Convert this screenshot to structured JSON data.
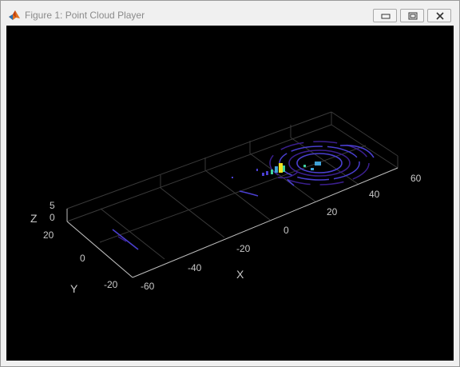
{
  "window": {
    "title": "Figure 1: Point Cloud Player",
    "icon": "matlab-icon",
    "buttons": [
      "minimize-icon",
      "maximize-icon",
      "close-icon"
    ]
  },
  "plot": {
    "background_color": "#000000",
    "axis_color": "#c8c8c8",
    "point_colormap": [
      "#3b1f8f",
      "#4a3fd0",
      "#3fa2d8",
      "#3fd0a0",
      "#f0e020"
    ],
    "axes": {
      "x": {
        "label": "X",
        "ticks": [
          "-60",
          "-40",
          "-20",
          "0",
          "20",
          "40",
          "60"
        ]
      },
      "y": {
        "label": "Y",
        "ticks": [
          "-20",
          "0",
          "20"
        ]
      },
      "z": {
        "label": "Z",
        "ticks": [
          "0",
          "5"
        ]
      }
    }
  }
}
